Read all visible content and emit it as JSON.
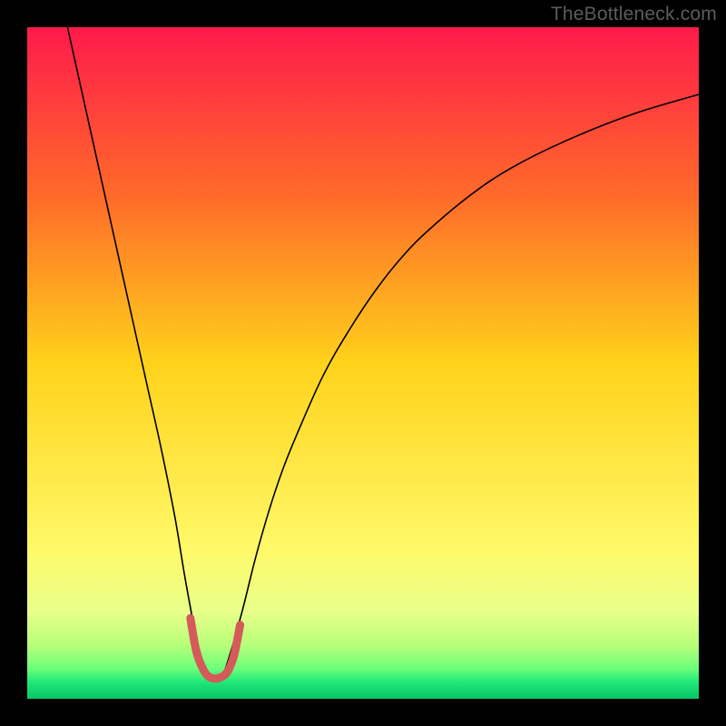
{
  "watermark": "TheBottleneck.com",
  "chart_data": {
    "type": "line",
    "title": "",
    "xlabel": "",
    "ylabel": "",
    "xlim": [
      0,
      100
    ],
    "ylim": [
      0,
      100
    ],
    "grid": false,
    "legend": false,
    "gradient_stops": [
      {
        "offset": 0.0,
        "color": "#ff1a4b"
      },
      {
        "offset": 0.25,
        "color": "#ff6a2a"
      },
      {
        "offset": 0.5,
        "color": "#ffd21a"
      },
      {
        "offset": 0.78,
        "color": "#fff96a"
      },
      {
        "offset": 0.87,
        "color": "#e8ff8a"
      },
      {
        "offset": 0.92,
        "color": "#b8ff7a"
      },
      {
        "offset": 0.955,
        "color": "#6dff7a"
      },
      {
        "offset": 0.975,
        "color": "#20e878"
      },
      {
        "offset": 1.0,
        "color": "#08c565"
      }
    ],
    "series": [
      {
        "name": "bottleneck-curve",
        "stroke": "#000000",
        "stroke_width": 1.6,
        "x": [
          6,
          8,
          10,
          12,
          14,
          16,
          18,
          20,
          22,
          23.5,
          25,
          26,
          27,
          28,
          29,
          30,
          32,
          34,
          36,
          38,
          40,
          44,
          48,
          52,
          56,
          60,
          66,
          72,
          80,
          90,
          100
        ],
        "values": [
          100,
          91,
          82,
          73,
          64,
          55,
          46,
          37,
          27,
          18,
          10,
          6,
          3.5,
          3,
          3.5,
          6,
          13,
          21,
          28,
          34,
          39,
          48,
          55,
          61,
          66,
          70,
          75,
          79,
          83,
          87,
          90
        ]
      },
      {
        "name": "highlight-valley",
        "stroke": "#d55a5a",
        "stroke_width": 9,
        "linecap": "round",
        "x": [
          24.3,
          25.2,
          26.3,
          27.2,
          28.0,
          28.8,
          29.8,
          30.8,
          31.7
        ],
        "values": [
          12.0,
          7.0,
          4.2,
          3.2,
          3.0,
          3.2,
          4.0,
          6.5,
          11.0
        ]
      }
    ]
  }
}
